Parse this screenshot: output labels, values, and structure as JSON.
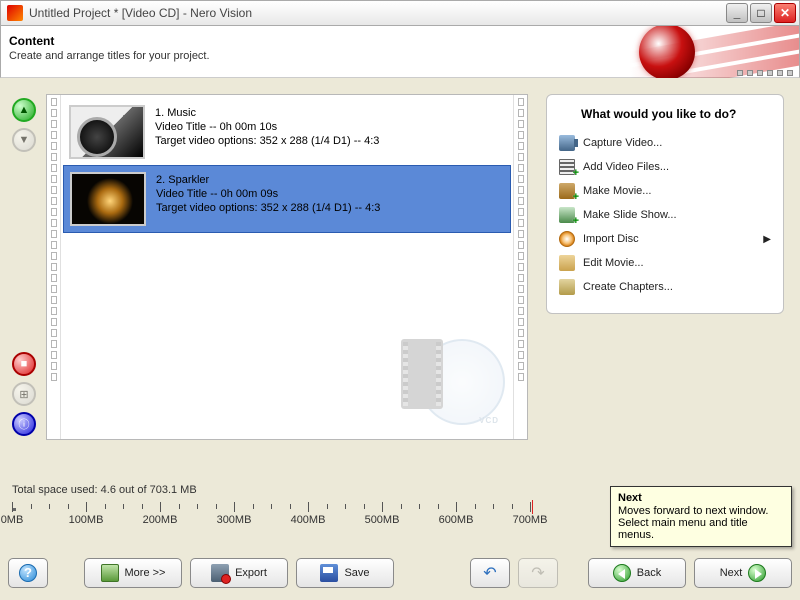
{
  "window": {
    "title": "Untitled Project * [Video CD] - Nero Vision"
  },
  "header": {
    "title": "Content",
    "subtitle": "Create and arrange titles for your project."
  },
  "clips": [
    {
      "index": "1.",
      "name": "Music",
      "line2": "Video Title -- 0h 00m 10s",
      "line3": "Target video options: 352 x 288 (1/4 D1) -- 4:3",
      "selected": false
    },
    {
      "index": "2.",
      "name": "Sparkler",
      "line2": "Video Title -- 0h 00m 09s",
      "line3": "Target video options: 352 x 288 (1/4 D1) -- 4:3",
      "selected": true
    }
  ],
  "watermark_label": "VCD",
  "side": {
    "title": "What would you like to do?",
    "items": [
      {
        "label": "Capture Video...",
        "icon": "camera"
      },
      {
        "label": "Add Video Files...",
        "icon": "film-add"
      },
      {
        "label": "Make Movie...",
        "icon": "movie"
      },
      {
        "label": "Make Slide Show...",
        "icon": "slideshow"
      },
      {
        "label": "Import Disc",
        "icon": "disc",
        "arrow": true
      },
      {
        "label": "Edit Movie...",
        "icon": "edit"
      },
      {
        "label": "Create Chapters...",
        "icon": "chapters"
      }
    ]
  },
  "space": {
    "label": "Total space used: 4.6 out of 703.1 MB",
    "used_mb": 4.6,
    "total_mb": 703.1,
    "ticks": [
      "0MB",
      "100MB",
      "200MB",
      "300MB",
      "400MB",
      "500MB",
      "600MB",
      "700MB"
    ]
  },
  "tooltip": {
    "title": "Next",
    "body": "Moves forward to next window. Select main menu and title menus."
  },
  "buttons": {
    "more": "More >>",
    "export": "Export",
    "save": "Save",
    "back": "Back",
    "next": "Next"
  }
}
